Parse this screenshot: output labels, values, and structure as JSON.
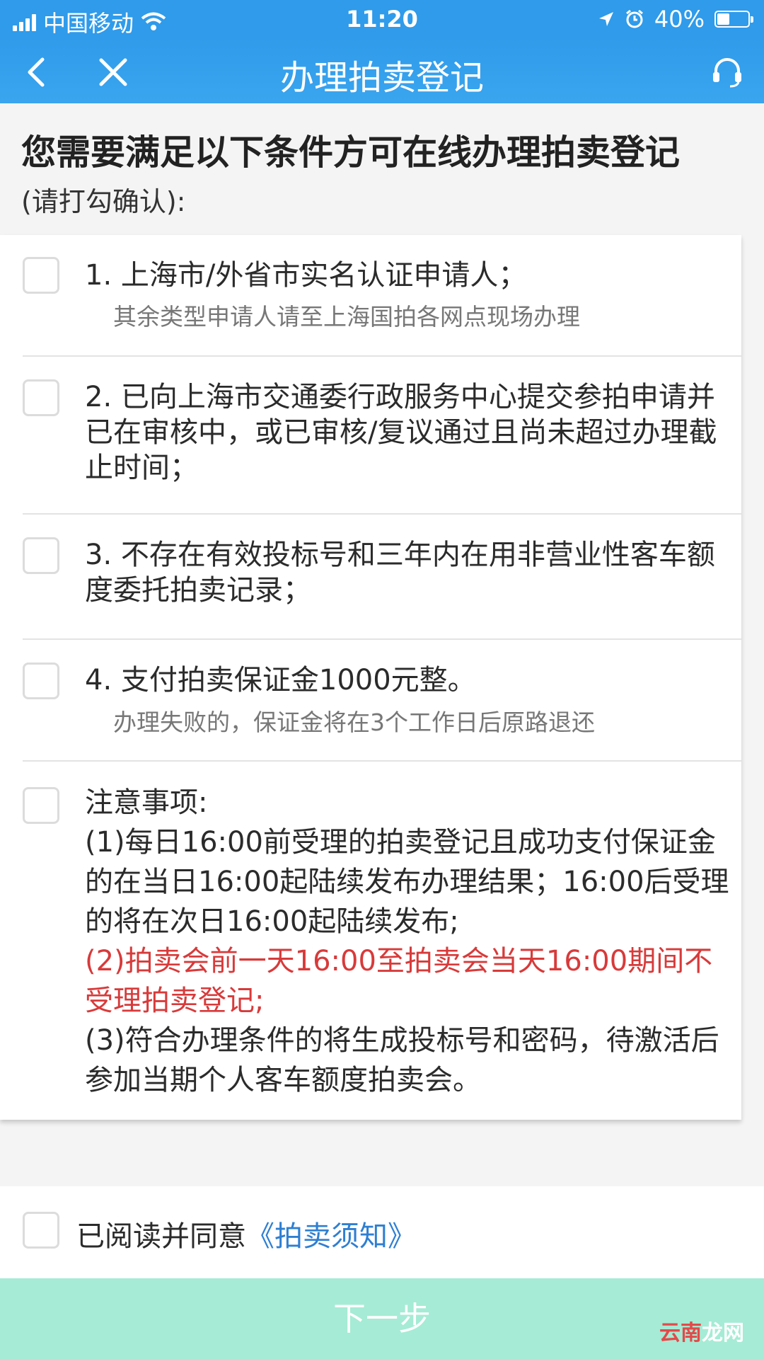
{
  "status_bar": {
    "carrier": "中国移动",
    "time": "11:20",
    "battery": "40%",
    "battery_level": 0.4
  },
  "nav": {
    "title": "办理拍卖登记",
    "back_icon": "chevron-left-icon",
    "close_icon": "close-icon",
    "support_icon": "headset-icon"
  },
  "header": {
    "title": "您需要满足以下条件方可在线办理拍卖登记",
    "subtitle": "(请打勾确认):"
  },
  "conditions": [
    {
      "main": "1. 上海市/外省市实名认证申请人；",
      "sub": "其余类型申请人请至上海国拍各网点现场办理"
    },
    {
      "main": "2. 已向上海市交通委行政服务中心提交参拍申请并已在审核中，或已审核/复议通过且尚未超过办理截止时间；",
      "sub": ""
    },
    {
      "main": "3. 不存在有效投标号和三年内在用非营业性客车额度委托拍卖记录；",
      "sub": ""
    },
    {
      "main": "4. 支付拍卖保证金1000元整。",
      "sub": "办理失败的，保证金将在3个工作日后原路退还"
    }
  ],
  "notes": {
    "heading": "注意事项:",
    "items": [
      "(1)每日16:00前受理的拍卖登记且成功支付保证金的在当日16:00起陆续发布办理结果；16:00后受理的将在次日16:00起陆续发布;",
      "(2)拍卖会前一天16:00至拍卖会当天16:00期间不受理拍卖登记;",
      "(3)符合办理条件的将生成投标号和密码，待激活后参加当期个人客车额度拍卖会。"
    ]
  },
  "agreement": {
    "prefix": "已阅读并同意",
    "link": "《拍卖须知》"
  },
  "next_button": "下一步",
  "watermark": {
    "part1": "云南",
    "part2": "龙网"
  },
  "colors": {
    "nav_blue": "#2f9bea",
    "link_blue": "#2e7fd2",
    "warning_red": "#d83a3a",
    "button_green": "#a6ebd5"
  }
}
